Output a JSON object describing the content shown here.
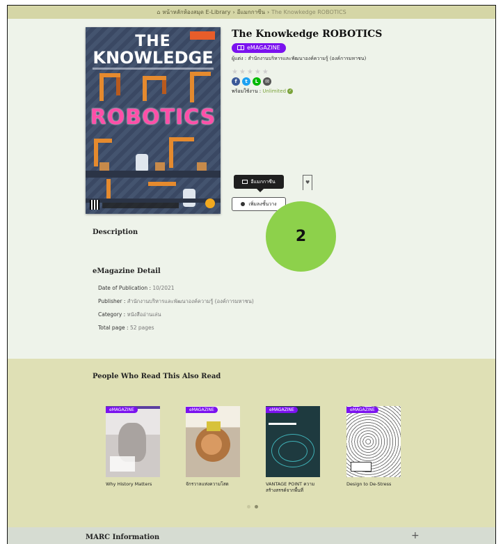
{
  "breadcrumb": {
    "home": "หน้าหลักห้องสมุด E-Library",
    "category": "อีแมกกาซีน",
    "current": "The Knowkedge ROBOTICS"
  },
  "book": {
    "title": "The Knowkedge ROBOTICS",
    "badge": "eMAGAZINE",
    "author": "ผู้แต่ง : สำนักงานบริหารและพัฒนาองค์ความรู้ (องค์การมหาชน)",
    "stars": "★★★★★",
    "availability_label": "พร้อมใช้งาน : ",
    "availability_value": "Unlimited",
    "cover": {
      "line1": "THE",
      "line2": "KNOWLEDGE",
      "line3": "ROBOTICS"
    }
  },
  "social": [
    {
      "icon": "facebook-icon",
      "glyph": "f",
      "color": "#3b5998"
    },
    {
      "icon": "twitter-icon",
      "glyph": "t",
      "color": "#1da1f2"
    },
    {
      "icon": "line-icon",
      "glyph": "L",
      "color": "#00b900"
    },
    {
      "icon": "email-icon",
      "glyph": "✉",
      "color": "#555555"
    }
  ],
  "actions": {
    "tooltip": "อีแมกกาซีน",
    "add_shelf": "เพิ่มลงชั้นวาง"
  },
  "step_marker": "2",
  "sections": {
    "description": "Description",
    "detail": "eMagazine Detail",
    "also_read": "People Who Read This Also Read",
    "marc": "MARC Information"
  },
  "detail": {
    "date_label": "Date of Publication : ",
    "date_value": "10/2021",
    "publisher_label": "Publisher : ",
    "publisher_value": "สำนักงานบริหารและพัฒนาองค์ความรู้ (องค์การมหาชน)",
    "category_label": "Category : ",
    "category_value": "หนังสืออ่านเล่น",
    "pages_label": "Total page : ",
    "pages_value": "52 pages"
  },
  "also_read": [
    {
      "title": "Why History Matters",
      "badge": "eMAGAZINE"
    },
    {
      "title": "จักรวาลแห่งความโสด",
      "badge": "eMAGAZINE"
    },
    {
      "title": "VANTAGE POINT ความสร้างสรรค์จากพื้นที่",
      "badge": "eMAGAZINE"
    },
    {
      "title": "Design to De-Stress",
      "badge": "eMAGAZINE"
    }
  ],
  "colors": {
    "accent": "#7b12ef",
    "available": "#7aa33a",
    "marker": "#8dd14b"
  }
}
